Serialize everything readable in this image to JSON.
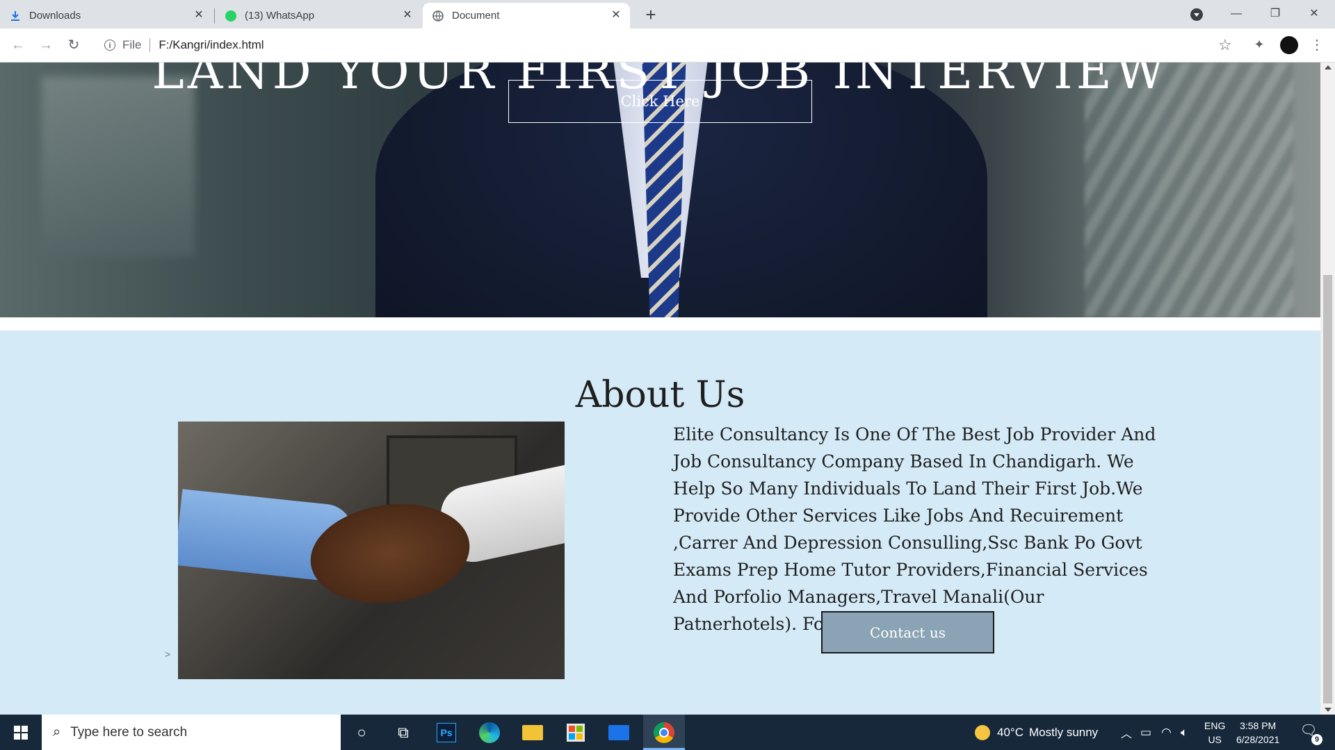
{
  "browser": {
    "tabs": [
      {
        "label": "Downloads",
        "icon": "download-icon"
      },
      {
        "label": "(13) WhatsApp",
        "icon": "whatsapp-icon",
        "badge": "13"
      },
      {
        "label": "Document",
        "icon": "globe-icon"
      }
    ],
    "active_tab": 2,
    "address": {
      "scheme_label": "File",
      "url": "F:/Kangri/index.html"
    }
  },
  "hero": {
    "title": "LAND YOUR FIRST JOB INTERVIEW",
    "button_label": "Click Here"
  },
  "about": {
    "title": "About Us",
    "body": "Elite Consultancy Is One Of The Best Job Provider And Job Consultancy Company Based In Chandigarh. We Help So Many Individuals To Land Their First Job.We Provide Other Services Like Jobs And Recuirement ,Carrer And Depression Consulling,Ssc Bank Po Govt Exams Prep Home Tutor Providers,Financial Services And Porfolio Managers,Travel Manali(Our Patnerhotels). For More Enqueries:",
    "contact_label": "Contact us",
    "arrow_glyph": ">",
    "background_color": "#d4eaf7",
    "contact_button_color": "#8aa3b5"
  },
  "taskbar": {
    "search_placeholder": "Type here to search",
    "weather_temp": "40°C",
    "weather_desc": "Mostly sunny",
    "lang_top": "ENG",
    "lang_bottom": "US",
    "time": "3:58 PM",
    "date": "6/28/2021",
    "notification_count": "9",
    "background_color": "#16283a"
  }
}
